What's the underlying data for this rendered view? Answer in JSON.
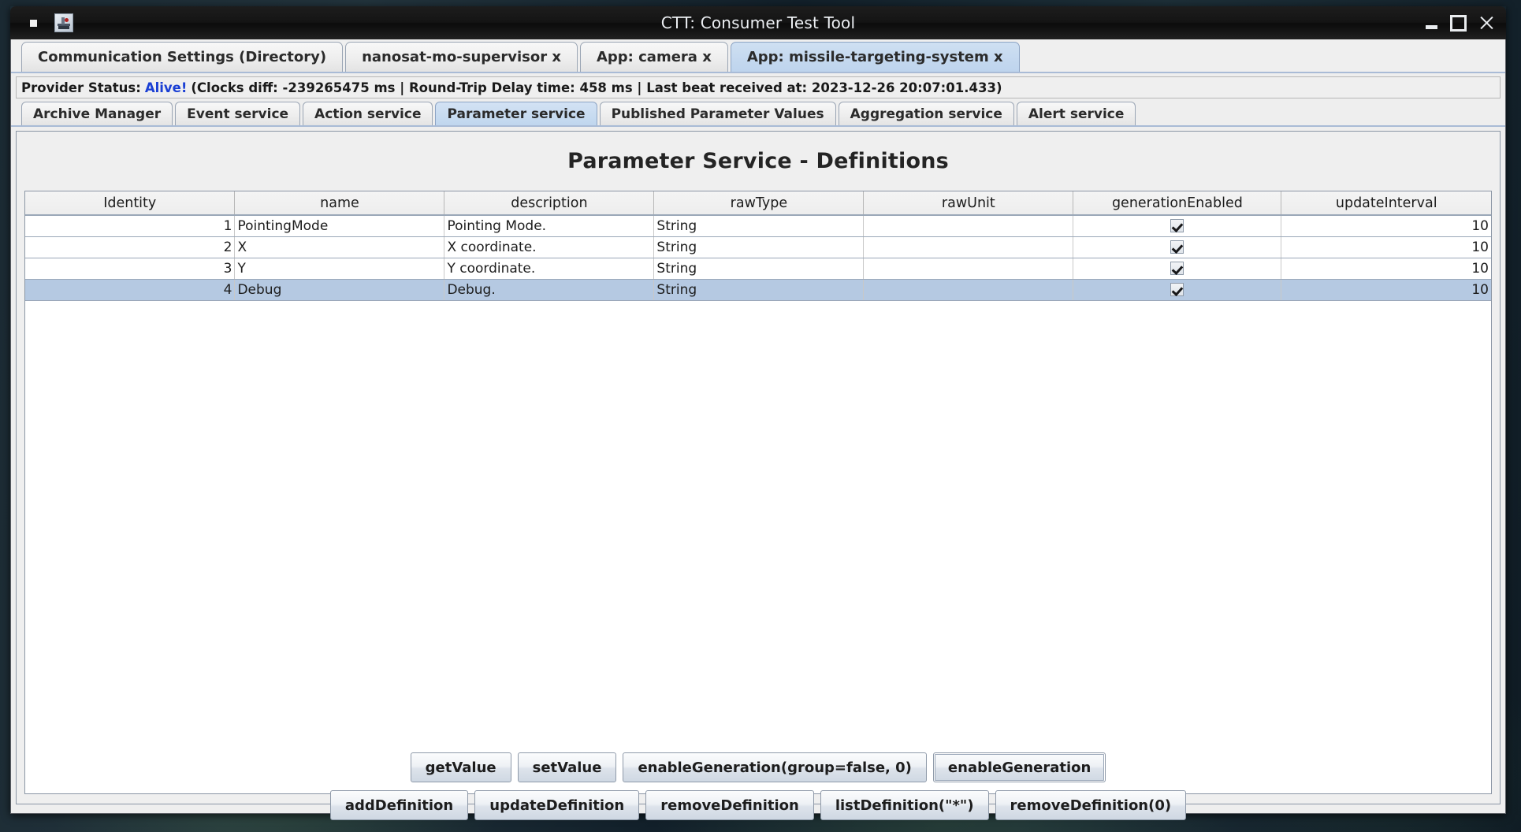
{
  "window": {
    "title": "CTT: Consumer Test Tool",
    "app_icon": "app-icon",
    "controls": {
      "minimize": "minimize-icon",
      "maximize": "maximize-icon",
      "close": "close-icon"
    }
  },
  "top_tabs": [
    {
      "label": "Communication Settings (Directory)",
      "selected": false
    },
    {
      "label": "nanosat-mo-supervisor x",
      "selected": false
    },
    {
      "label": "App: camera x",
      "selected": false
    },
    {
      "label": "App: missile-targeting-system x",
      "selected": true
    }
  ],
  "status": {
    "prefix": "Provider Status:",
    "state": "Alive!",
    "details": "(Clocks diff: -239265475 ms | Round-Trip Delay time: 458 ms | Last beat received at: 2023-12-26 20:07:01.433)",
    "alive_color": "#1a3fd4"
  },
  "service_tabs": [
    {
      "label": "Archive Manager",
      "selected": false
    },
    {
      "label": "Event service",
      "selected": false
    },
    {
      "label": "Action service",
      "selected": false
    },
    {
      "label": "Parameter service",
      "selected": true
    },
    {
      "label": "Published Parameter Values",
      "selected": false
    },
    {
      "label": "Aggregation service",
      "selected": false
    },
    {
      "label": "Alert service",
      "selected": false
    }
  ],
  "panel": {
    "title": "Parameter Service - Definitions"
  },
  "table": {
    "columns": [
      "Identity",
      "name",
      "description",
      "rawType",
      "rawUnit",
      "generationEnabled",
      "updateInterval"
    ],
    "rows": [
      {
        "identity": "1",
        "name": "PointingMode",
        "description": "Pointing Mode.",
        "rawType": "String",
        "rawUnit": "",
        "generationEnabled": true,
        "updateInterval": "10",
        "selected": false
      },
      {
        "identity": "2",
        "name": "X",
        "description": "X coordinate.",
        "rawType": "String",
        "rawUnit": "",
        "generationEnabled": true,
        "updateInterval": "10",
        "selected": false
      },
      {
        "identity": "3",
        "name": "Y",
        "description": "Y coordinate.",
        "rawType": "String",
        "rawUnit": "",
        "generationEnabled": true,
        "updateInterval": "10",
        "selected": false
      },
      {
        "identity": "4",
        "name": "Debug",
        "description": "Debug.",
        "rawType": "String",
        "rawUnit": "",
        "generationEnabled": true,
        "updateInterval": "10",
        "selected": true
      }
    ],
    "selected_row_color": "#b5c9e2"
  },
  "buttons": {
    "row1": [
      {
        "label": "getValue",
        "focused": false
      },
      {
        "label": "setValue",
        "focused": false
      },
      {
        "label": "enableGeneration(group=false, 0)",
        "focused": false
      },
      {
        "label": "enableGeneration",
        "focused": true
      }
    ],
    "row2": [
      {
        "label": "addDefinition",
        "focused": false
      },
      {
        "label": "updateDefinition",
        "focused": false
      },
      {
        "label": "removeDefinition",
        "focused": false
      },
      {
        "label": "listDefinition(\"*\")",
        "focused": false
      },
      {
        "label": "removeDefinition(0)",
        "focused": false
      }
    ]
  }
}
